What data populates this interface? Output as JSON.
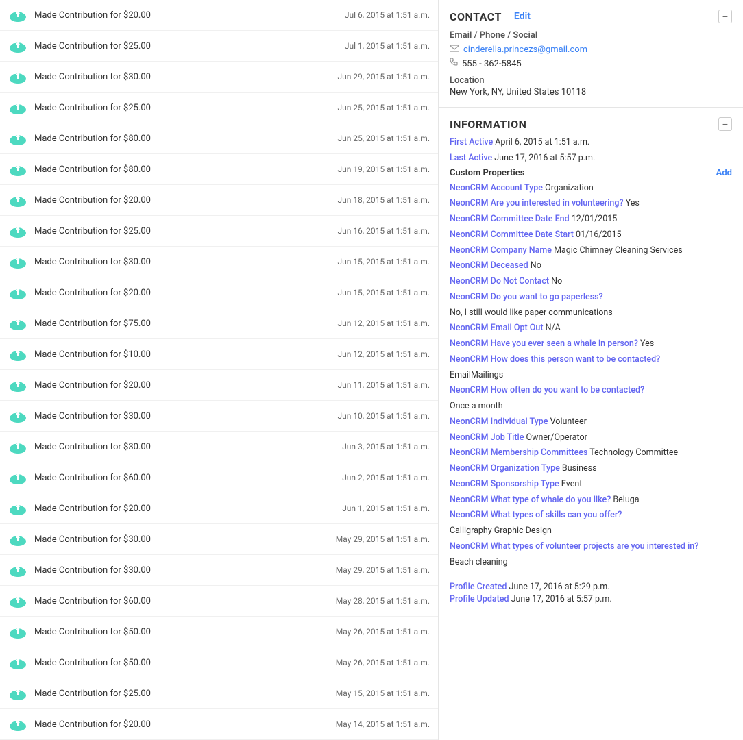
{
  "contact": {
    "title": "CONTACT",
    "edit_label": "Edit",
    "collapse_icon": "−",
    "subtitle": "Email / Phone / Social",
    "email": "cinderella.princezs@gmail.com",
    "phone": "555 - 362-5845",
    "location_label": "Location",
    "location_value": "New York, NY, United States 10118"
  },
  "information": {
    "title": "INFORMATION",
    "collapse_icon": "−",
    "first_active_label": "First Active",
    "first_active_value": "April 6, 2015 at 1:51 a.m.",
    "last_active_label": "Last Active",
    "last_active_value": "June 17, 2016 at 5:57 p.m.",
    "custom_properties_label": "Custom Properties",
    "add_label": "Add",
    "properties": [
      {
        "label": "NeonCRM Account Type",
        "value": "Organization"
      },
      {
        "label": "NeonCRM Are you interested in volunteering?",
        "value": "Yes"
      },
      {
        "label": "NeonCRM Committee Date End",
        "value": "12/01/2015"
      },
      {
        "label": "NeonCRM Committee Date Start",
        "value": "01/16/2015"
      },
      {
        "label": "NeonCRM Company Name",
        "value": "Magic Chimney Cleaning Services"
      },
      {
        "label": "NeonCRM Deceased",
        "value": "No"
      },
      {
        "label": "NeonCRM Do Not Contact",
        "value": "No"
      },
      {
        "label": "NeonCRM Do you want to go paperless?",
        "value": ""
      },
      {
        "label": "",
        "value": "No, I still would like paper communications"
      },
      {
        "label": "NeonCRM Email Opt Out",
        "value": "N/A"
      },
      {
        "label": "NeonCRM Have you ever seen a whale in person?",
        "value": "Yes"
      },
      {
        "label": "NeonCRM How does this person want to be contacted?",
        "value": ""
      },
      {
        "label": "",
        "value": "EmailMailings"
      },
      {
        "label": "NeonCRM How often do you want to be contacted?",
        "value": ""
      },
      {
        "label": "",
        "value": "Once a month"
      },
      {
        "label": "NeonCRM Individual Type",
        "value": "Volunteer"
      },
      {
        "label": "NeonCRM Job Title",
        "value": "Owner/Operator"
      },
      {
        "label": "NeonCRM Membership Committees",
        "value": "Technology Committee"
      },
      {
        "label": "NeonCRM Organization Type",
        "value": "Business"
      },
      {
        "label": "NeonCRM Sponsorship Type",
        "value": "Event"
      },
      {
        "label": "NeonCRM What type of whale do you like?",
        "value": "Beluga"
      },
      {
        "label": "NeonCRM What types of skills can you offer?",
        "value": ""
      },
      {
        "label": "",
        "value": "Calligraphy Graphic Design"
      },
      {
        "label": "NeonCRM What types of volunteer projects are you interested in?",
        "value": ""
      },
      {
        "label": "",
        "value": "Beach cleaning"
      }
    ],
    "profile_created_label": "Profile Created",
    "profile_created_value": "June 17, 2016 at 5:29 p.m.",
    "profile_updated_label": "Profile Updated",
    "profile_updated_value": "June 17, 2016 at 5:57 p.m."
  },
  "activities": [
    {
      "text": "Made Contribution for $20.00",
      "date": "Jul 6, 2015 at 1:51 a.m."
    },
    {
      "text": "Made Contribution for $25.00",
      "date": "Jul 1, 2015 at 1:51 a.m."
    },
    {
      "text": "Made Contribution for $30.00",
      "date": "Jun 29, 2015 at 1:51 a.m."
    },
    {
      "text": "Made Contribution for $25.00",
      "date": "Jun 25, 2015 at 1:51 a.m."
    },
    {
      "text": "Made Contribution for $80.00",
      "date": "Jun 25, 2015 at 1:51 a.m."
    },
    {
      "text": "Made Contribution for $80.00",
      "date": "Jun 19, 2015 at 1:51 a.m."
    },
    {
      "text": "Made Contribution for $20.00",
      "date": "Jun 18, 2015 at 1:51 a.m."
    },
    {
      "text": "Made Contribution for $25.00",
      "date": "Jun 16, 2015 at 1:51 a.m."
    },
    {
      "text": "Made Contribution for $30.00",
      "date": "Jun 15, 2015 at 1:51 a.m."
    },
    {
      "text": "Made Contribution for $20.00",
      "date": "Jun 15, 2015 at 1:51 a.m."
    },
    {
      "text": "Made Contribution for $75.00",
      "date": "Jun 12, 2015 at 1:51 a.m."
    },
    {
      "text": "Made Contribution for $10.00",
      "date": "Jun 12, 2015 at 1:51 a.m."
    },
    {
      "text": "Made Contribution for $20.00",
      "date": "Jun 11, 2015 at 1:51 a.m."
    },
    {
      "text": "Made Contribution for $30.00",
      "date": "Jun 10, 2015 at 1:51 a.m."
    },
    {
      "text": "Made Contribution for $30.00",
      "date": "Jun 3, 2015 at 1:51 a.m."
    },
    {
      "text": "Made Contribution for $60.00",
      "date": "Jun 2, 2015 at 1:51 a.m."
    },
    {
      "text": "Made Contribution for $20.00",
      "date": "Jun 1, 2015 at 1:51 a.m."
    },
    {
      "text": "Made Contribution for $30.00",
      "date": "May 29, 2015 at 1:51 a.m."
    },
    {
      "text": "Made Contribution for $30.00",
      "date": "May 29, 2015 at 1:51 a.m."
    },
    {
      "text": "Made Contribution for $60.00",
      "date": "May 28, 2015 at 1:51 a.m."
    },
    {
      "text": "Made Contribution for $50.00",
      "date": "May 26, 2015 at 1:51 a.m."
    },
    {
      "text": "Made Contribution for $50.00",
      "date": "May 26, 2015 at 1:51 a.m."
    },
    {
      "text": "Made Contribution for $25.00",
      "date": "May 15, 2015 at 1:51 a.m."
    },
    {
      "text": "Made Contribution for $20.00",
      "date": "May 14, 2015 at 1:51 a.m."
    }
  ]
}
